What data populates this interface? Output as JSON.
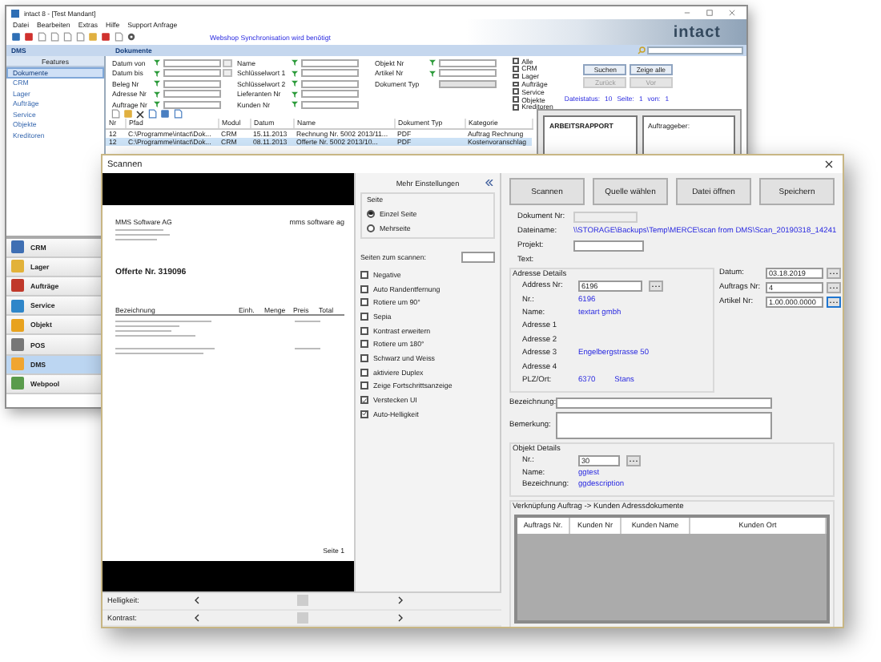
{
  "main_window": {
    "title": "intact 8 - [Test Mandant]",
    "menu": [
      "Datei",
      "Bearbeiten",
      "Extras",
      "Hilfe",
      "Support Anfrage"
    ],
    "notice": "Webshop Synchronisation wird benötigt",
    "logo": "intact",
    "sidebar": {
      "title": "DMS",
      "pane": "Features",
      "items": [
        {
          "label": "Dokumente",
          "selected": true
        },
        {
          "label": "CRM",
          "selected": false
        },
        {
          "label": "Lager",
          "selected": false
        },
        {
          "label": "Aufträge",
          "selected": false
        },
        {
          "label": "Service",
          "selected": false
        },
        {
          "label": "Objekte",
          "selected": false
        },
        {
          "label": "Kreditoren",
          "selected": false
        }
      ],
      "modules": [
        {
          "label": "CRM",
          "selected": false
        },
        {
          "label": "Lager",
          "selected": false
        },
        {
          "label": "Aufträge",
          "selected": false
        },
        {
          "label": "Service",
          "selected": false
        },
        {
          "label": "Objekt",
          "selected": false
        },
        {
          "label": "POS",
          "selected": false
        },
        {
          "label": "DMS",
          "selected": true
        },
        {
          "label": "Webpool",
          "selected": false
        }
      ]
    },
    "documents": {
      "title": "Dokumente",
      "filter_columns": [
        [
          {
            "label": "Datum von",
            "kind": "date"
          },
          {
            "label": "Datum bis",
            "kind": "date"
          },
          {
            "label": "Beleg Nr",
            "kind": "field"
          },
          {
            "label": "Adresse Nr",
            "kind": "field"
          },
          {
            "label": "Auftrage Nr",
            "kind": "field"
          }
        ],
        [
          {
            "label": "Name",
            "kind": "field"
          },
          {
            "label": "Schlüsselwort 1",
            "kind": "field"
          },
          {
            "label": "Schlüsselwort 2",
            "kind": "field"
          },
          {
            "label": "Lieferanten Nr",
            "kind": "field"
          },
          {
            "label": "Kunden Nr",
            "kind": "field"
          }
        ],
        [
          {
            "label": "Objekt Nr",
            "kind": "field"
          },
          {
            "label": "Artikel Nr",
            "kind": "field"
          },
          {
            "label": "Dokument Typ",
            "kind": "dropdown"
          }
        ]
      ],
      "categories": [
        {
          "label": "Alle",
          "checked": false
        },
        {
          "label": "CRM",
          "checked": false
        },
        {
          "label": "Lager",
          "checked": false
        },
        {
          "label": "Aufträge",
          "checked": false
        },
        {
          "label": "Service",
          "checked": false
        },
        {
          "label": "Objekte",
          "checked": false
        },
        {
          "label": "Kreditoren",
          "checked": false
        }
      ],
      "buttons": [
        {
          "label": "Suchen",
          "disabled": false
        },
        {
          "label": "Zeige alle",
          "disabled": false
        },
        {
          "label": "Zurück",
          "disabled": true
        },
        {
          "label": "Vor",
          "disabled": true
        }
      ],
      "status": [
        "Dateistatus:",
        "10",
        "Seite:",
        "1",
        "von:",
        "1"
      ],
      "table": {
        "columns": [
          "Nr",
          "Pfad",
          "Modul",
          "Datum",
          "Name",
          "Dokument Typ",
          "Kategorie"
        ],
        "rows": [
          {
            "cells": [
              "12",
              "C:\\Programme\\intact\\Dok...",
              "CRM",
              "15.11.2013",
              "Rechnung Nr. 5002 2013/11...",
              "PDF",
              "Auftrag Rechnung"
            ],
            "selected": false
          },
          {
            "cells": [
              "12",
              "C:\\Programme\\intact\\Dok...",
              "CRM",
              "08.11.2013",
              "Offerte Nr. 5002 2013/10...",
              "PDF",
              "Kostenvoranschlag"
            ],
            "selected": true
          }
        ]
      },
      "preview": {
        "title": "ARBEITSRAPPORT",
        "label": "Auftraggeber:"
      }
    }
  },
  "scan_dialog": {
    "title": "Scannen",
    "document": {
      "company": "MMS Software AG",
      "logo": "mms software ag",
      "heading": "Offerte Nr. 319096",
      "columns": [
        "Bezeichnung",
        "Einh.",
        "Menge",
        "Preis",
        "Total"
      ],
      "footer": "Seite 1"
    },
    "adjustments": [
      {
        "label": "Helligkeit:",
        "level": 0.5
      },
      {
        "label": "Kontrast:",
        "level": 0.5
      }
    ],
    "settings": {
      "title": "Mehr Einstellungen",
      "page_group": "Seite",
      "page_options": [
        {
          "label": "Einzel Seite",
          "selected": true
        },
        {
          "label": "Mehrseite",
          "selected": false
        }
      ],
      "pages_label": "Seiten zum scannen:",
      "options": [
        {
          "label": "Negative",
          "checked": false
        },
        {
          "label": "Auto Randentfernung",
          "checked": false
        },
        {
          "label": "Rotiere um 90°",
          "checked": false
        },
        {
          "label": "Sepia",
          "checked": false
        },
        {
          "label": "Kontrast erweitern",
          "checked": false
        },
        {
          "label": "Rotiere um 180°",
          "checked": false
        },
        {
          "label": "Schwarz und Weiss",
          "checked": false
        },
        {
          "label": "aktiviere Duplex",
          "checked": false
        },
        {
          "label": "Zeige Fortschrittsanzeige",
          "checked": false
        },
        {
          "label": "Verstecken UI",
          "checked": true
        },
        {
          "label": "Auto-Helligkeit",
          "checked": true
        }
      ]
    },
    "actions": [
      "Scannen",
      "Quelle wählen",
      "Datei öffnen",
      "Speichern"
    ],
    "document_nr_label": "Dokument Nr:",
    "filename_label": "Dateiname:",
    "filename": "\\\\STORAGE\\Backups\\Temp\\MERCE\\scan from DMS\\Scan_20190318_14241",
    "project_label": "Projekt:",
    "text_label": "Text:",
    "address": {
      "title": "Adresse Details",
      "nr_label": "Address Nr:",
      "nr_value": "6196",
      "lines": [
        {
          "label": "Nr.:",
          "values": [
            "6196"
          ]
        },
        {
          "label": "Name:",
          "values": [
            "textart gmbh"
          ]
        },
        {
          "label": "Adresse 1"
        },
        {
          "label": "Adresse 2"
        },
        {
          "label": "Adresse 3",
          "values": [
            "Engelbergstrasse 50"
          ]
        },
        {
          "label": "Adresse 4"
        },
        {
          "label": "PLZ/Ort:",
          "values": [
            "6370",
            "Stans"
          ]
        }
      ]
    },
    "side_fields": [
      {
        "label": "Datum:",
        "value": "03.18.2019",
        "focused": false
      },
      {
        "label": "Auftrags Nr:",
        "value": "4",
        "focused": false
      },
      {
        "label": "Artikel Nr:",
        "value": "1.00.000.0000",
        "focused": true
      }
    ],
    "designation_label": "Bezeichnung:",
    "remark_label": "Bemerkung:",
    "object": {
      "title": "Objekt Details",
      "nr_label": "Nr.:",
      "nr_value": "30",
      "lines": [
        {
          "label": "Name:",
          "value": "ggtest"
        },
        {
          "label": "Bezeichnung:",
          "value": "ggdescription"
        }
      ]
    },
    "link": {
      "title": "Verknüpfung Auftrag -> Kunden Adressdokumente",
      "columns": [
        "Auftrags Nr.",
        "Kunden Nr",
        "Kunden Name",
        "Kunden Ort"
      ]
    }
  }
}
